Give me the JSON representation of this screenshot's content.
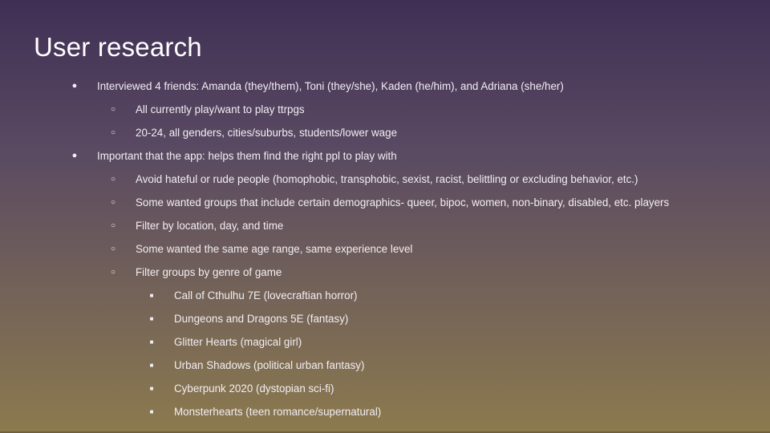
{
  "slide": {
    "title": "User research",
    "bullets": [
      {
        "level": 1,
        "marker": "●",
        "text": "Interviewed 4 friends: Amanda (they/them), Toni (they/she), Kaden (he/him), and Adriana (she/her)"
      },
      {
        "level": 2,
        "marker": "○",
        "text": "All currently play/want to play ttrpgs"
      },
      {
        "level": 2,
        "marker": "○",
        "text": "20-24, all genders, cities/suburbs, students/lower wage"
      },
      {
        "level": 1,
        "marker": "●",
        "text": "Important that the app: helps them find the right ppl to play with"
      },
      {
        "level": 2,
        "marker": "○",
        "text": "Avoid hateful or rude people (homophobic, transphobic, sexist, racist, belittling or excluding behavior, etc.)"
      },
      {
        "level": 2,
        "marker": "○",
        "text": "Some wanted groups that include certain demographics- queer, bipoc, women, non-binary, disabled, etc. players"
      },
      {
        "level": 2,
        "marker": "○",
        "text": "Filter by location, day, and time"
      },
      {
        "level": 2,
        "marker": "○",
        "text": "Some wanted the same age range, same experience level"
      },
      {
        "level": 2,
        "marker": "○",
        "text": "Filter groups by genre of game"
      },
      {
        "level": 3,
        "marker": "■",
        "text": "Call of Cthulhu 7E (lovecraftian horror)"
      },
      {
        "level": 3,
        "marker": "■",
        "text": "Dungeons and Dragons 5E (fantasy)"
      },
      {
        "level": 3,
        "marker": "■",
        "text": "Glitter Hearts (magical girl)"
      },
      {
        "level": 3,
        "marker": "■",
        "text": "Urban Shadows (political urban fantasy)"
      },
      {
        "level": 3,
        "marker": "■",
        "text": "Cyberpunk 2020 (dystopian sci-fi)"
      },
      {
        "level": 3,
        "marker": "■",
        "text": "Monsterhearts (teen romance/supernatural)"
      }
    ]
  },
  "colors": {
    "background_top": "#3f2f55",
    "background_bottom": "#8c7a4e",
    "text": "#ffffff"
  }
}
